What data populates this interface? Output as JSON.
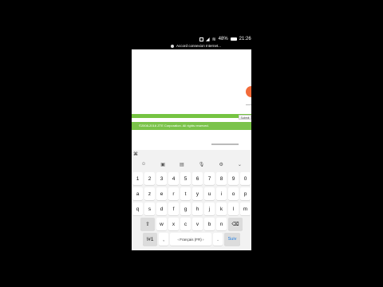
{
  "status_bar": {
    "battery": "48%",
    "time": "21:26",
    "icons": [
      "screenshot-icon",
      "signal-icon",
      "wifi-icon",
      "battery-icon"
    ]
  },
  "notification": {
    "text": "Accord connexion Internet..."
  },
  "web": {
    "submit_label": "Submit",
    "footer_text": "©2008-2016 ZTE Corporation. All rights reserved.",
    "colors": {
      "green": "#76c442",
      "orange": "#f26b3a"
    }
  },
  "keyboard": {
    "toolbar_icons": [
      "emoji-icon",
      "sticker-icon",
      "gif-icon",
      "mic-icon",
      "settings-icon",
      "collapse-icon"
    ],
    "rows": [
      [
        "1",
        "2",
        "3",
        "4",
        "5",
        "6",
        "7",
        "8",
        "9",
        "0"
      ],
      [
        "a",
        "z",
        "e",
        "r",
        "t",
        "y",
        "u",
        "i",
        "o",
        "p"
      ],
      [
        "q",
        "s",
        "d",
        "f",
        "g",
        "h",
        "j",
        "k",
        "l",
        "m"
      ],
      [
        "w",
        "x",
        "c",
        "v",
        "b",
        "n"
      ]
    ],
    "bottom": {
      "symbols_label": "!#1",
      "comma_label": ",",
      "space_label": "‹ Français (FR) ›",
      "period_label": ".",
      "enter_label": "Suiv"
    }
  }
}
